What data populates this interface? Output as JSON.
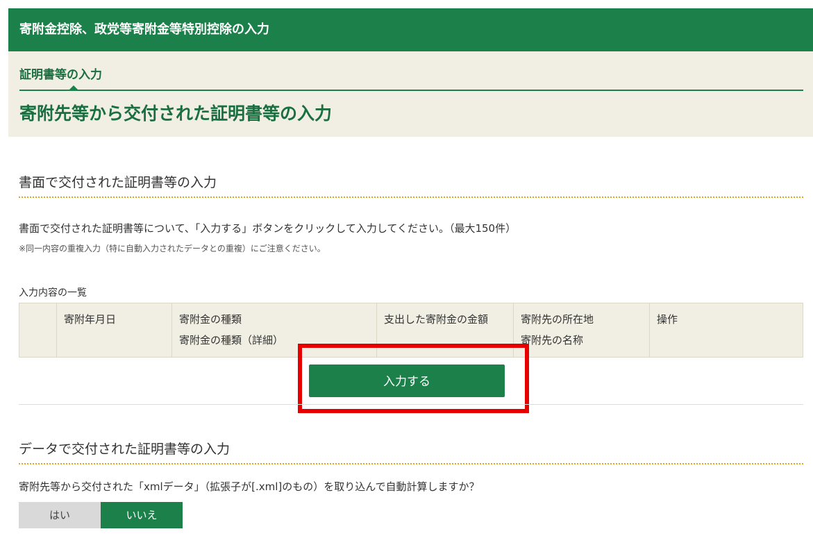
{
  "header": {
    "title": "寄附金控除、政党等寄附金等特別控除の入力",
    "step_label": "証明書等の入力",
    "page_title": "寄附先等から交付された証明書等の入力"
  },
  "paper_section": {
    "title": "書面で交付された証明書等の入力",
    "description": "書面で交付された証明書等について、「入力する」ボタンをクリックして入力してください。（最大150件）",
    "note": "※同一内容の重複入力（特に自動入力されたデータとの重複）にご注意ください。",
    "list_caption": "入力内容の一覧",
    "table_headers": {
      "col0": "",
      "date": "寄附年月日",
      "type": "寄附金の種類",
      "type_detail": "寄附金の種類（詳細）",
      "amount": "支出した寄附金の金額",
      "address": "寄附先の所在地",
      "name": "寄附先の名称",
      "action": "操作"
    },
    "input_button_label": "入力する"
  },
  "data_section": {
    "title": "データで交付された証明書等の入力",
    "question": "寄附先等から交付された「xmlデータ」（拡張子が[.xml]のもの）を取り込んで自動計算しますか？",
    "options": {
      "yes": "はい",
      "no": "いいえ"
    },
    "selected": "いいえ"
  },
  "colors": {
    "brand_green": "#1b8049",
    "panel_beige": "#f1efe4",
    "dotted_orange": "#e0a21a",
    "highlight_red": "#e60000"
  }
}
